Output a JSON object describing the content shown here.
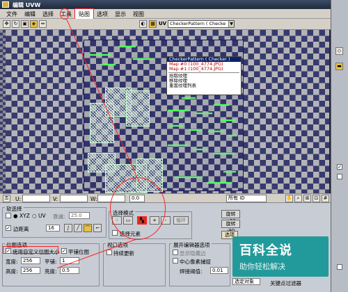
{
  "window": {
    "title": "编辑 UVW"
  },
  "menu": [
    "文件",
    "编辑",
    "选择",
    "工具",
    "贴图",
    "选项",
    "显示",
    "视图"
  ],
  "toolbar": {
    "uv_label": "UV",
    "map_selector": "CheckerPattern  ( Checke"
  },
  "map_dropdown": {
    "items": [
      {
        "label": "CheckerPattern  ( Checker )",
        "selected": true
      },
      {
        "label": "Map #0 (100_4774.JPG)",
        "selected": false
      },
      {
        "label": "Map #1 (100_4774.JPG)",
        "selected": false
      },
      {
        "label": "拾取纹理",
        "selected": false
      },
      {
        "label": "移除纹理",
        "selected": false
      },
      {
        "label": "重置纹理列表",
        "selected": false
      }
    ]
  },
  "viewport_toolbar": {
    "u_label": "U:",
    "v_label": "V:",
    "w_label": "W:",
    "l_value": "0.0",
    "id_filter": "所有 ID"
  },
  "soft_select": {
    "title": "软选择",
    "xyz_label": "XYZ",
    "uv_label": "UV",
    "falloff_label": "衰减:",
    "falloff_value": "25.0",
    "edge_distance_label": "边距离",
    "edge_distance_value": "16"
  },
  "select_mode": {
    "title": "选择模式",
    "select_elements_label": "选择元素",
    "loop_label": "循环"
  },
  "rotate": {
    "plus90": "旋转 +90",
    "minus90": "旋转 -90"
  },
  "options_button": "选项",
  "bitmap_options": {
    "title": "位图选项",
    "use_custom_size": "使用自定义位图大小",
    "tile_bitmap": "平铺位图",
    "width_label": "宽度:",
    "width_value": "256",
    "height_label": "高度:",
    "height_value": "256",
    "tile_label": "平铺:",
    "tile_value": "1",
    "brightness_label": "亮度:",
    "brightness_value": "0.5"
  },
  "viewport_options": {
    "title": "视口选项",
    "constant_update": "持续更新"
  },
  "display_options": {
    "title": "展开编辑器选项",
    "show_hidden_edges": "显示隐藏边",
    "center_pixel_snap": "中心像素捕捉",
    "weld_threshold_label": "焊接阈值:",
    "weld_threshold_value": "0.01"
  },
  "bottom_right": {
    "dropdown": "选定对象",
    "keyframe_point": "关键点过滤器"
  },
  "watermark": {
    "title": "百科全说",
    "subtitle": "助你轻松解决"
  }
}
